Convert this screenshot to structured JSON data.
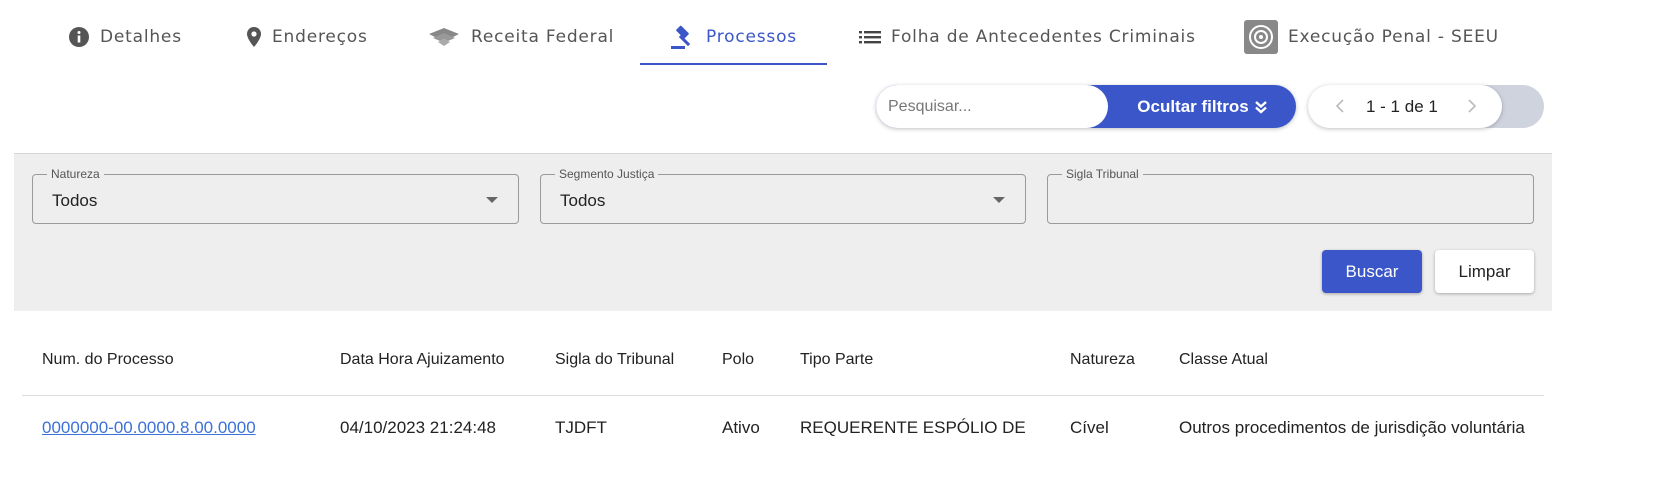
{
  "tabs": [
    {
      "label": "Detalhes",
      "icon": "info-icon"
    },
    {
      "label": "Endereços",
      "icon": "location-pin-icon"
    },
    {
      "label": "Receita Federal",
      "icon": "receita-federal-icon"
    },
    {
      "label": "Processos",
      "icon": "gavel-icon",
      "active": true
    },
    {
      "label": "Folha de Antecedentes Criminais",
      "icon": "list-icon"
    },
    {
      "label": "Execução Penal - SEEU",
      "icon": "seeu-icon"
    }
  ],
  "toolbar": {
    "search_placeholder": "Pesquisar...",
    "filter_toggle_label": "Ocultar filtros",
    "filter_toggle_icon": "double-chevron-down-icon",
    "pagination_label": "1 - 1 de 1"
  },
  "filters": {
    "natureza": {
      "label": "Natureza",
      "value": "Todos"
    },
    "segmento": {
      "label": "Segmento Justiça",
      "value": "Todos"
    },
    "sigla": {
      "label": "Sigla Tribunal",
      "value": ""
    },
    "search_button": "Buscar",
    "clear_button": "Limpar"
  },
  "table": {
    "columns": [
      "Num. do Processo",
      "Data Hora Ajuizamento",
      "Sigla do Tribunal",
      "Polo",
      "Tipo Parte",
      "Natureza",
      "Classe Atual"
    ],
    "rows": [
      [
        "0000000-00.0000.8.00.0000",
        "04/10/2023 21:24:48",
        "TJDFT",
        "Ativo",
        "REQUERENTE ESPÓLIO DE",
        "Cível",
        "Outros procedimentos de jurisdição voluntária"
      ]
    ]
  },
  "colors": {
    "accent": "#3a56c8",
    "link": "#3d72d8",
    "panel_bg": "#eeeeee"
  }
}
